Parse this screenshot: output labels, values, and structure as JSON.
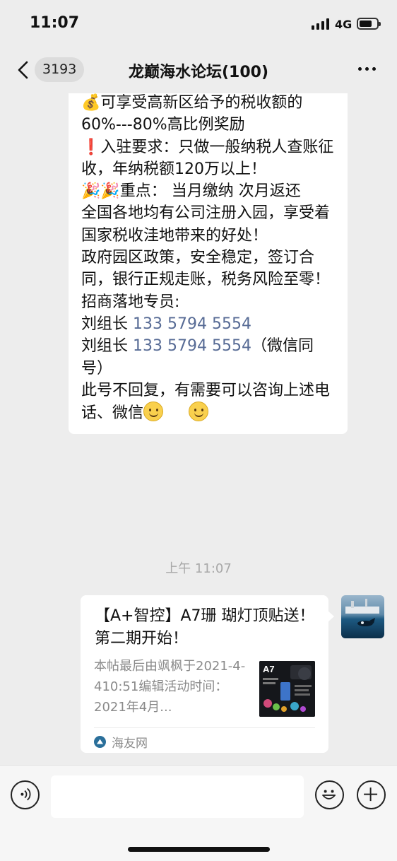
{
  "status_bar": {
    "time": "11:07",
    "network": "4G"
  },
  "nav": {
    "back_count": "3193",
    "title": "龙巅海水论坛(100)"
  },
  "message_text": {
    "lines": [
      {
        "emoji": "💰",
        "text": "可享受高新区给予的税收额的60%---80%高比例奖励"
      },
      {
        "emoji": "❗",
        "text": "入驻要求：只做一般纳税人查账征收，年纳税额120万以上！"
      },
      {
        "emoji": "🎉🎉",
        "text": "重点： 当月缴纳 次月返还"
      },
      {
        "emoji": "",
        "text": "全国各地均有公司注册入园，享受着国家税收洼地带来的好处！"
      },
      {
        "emoji": "",
        "text": "政府园区政策，安全稳定，签订合同，银行正规走账，税务风险至零！"
      },
      {
        "emoji": "",
        "text": "招商落地专员:"
      }
    ],
    "contact1_name": "刘组长",
    "contact1_phone": "133 5794 5554",
    "contact2_name": "刘组长",
    "contact2_phone": "133 5794 5554",
    "contact2_suffix": "（微信同号）",
    "closing": "此号不回复，有需要可以咨询上述电话、微信"
  },
  "timestamp": "上午 11:07",
  "link_card": {
    "title": "【A+智控】A7珊 瑚灯顶贴送！第二期开始！",
    "description": "本帖最后由飒枫于2021-4-410:51编辑活动时间：2021年4月...",
    "thumb_label": "A7",
    "source": "海友网"
  },
  "input": {
    "placeholder": ""
  },
  "colors": {
    "background": "#ededed",
    "bubble": "#ffffff",
    "link": "#576b95",
    "timestamp": "#a8a8a8"
  }
}
